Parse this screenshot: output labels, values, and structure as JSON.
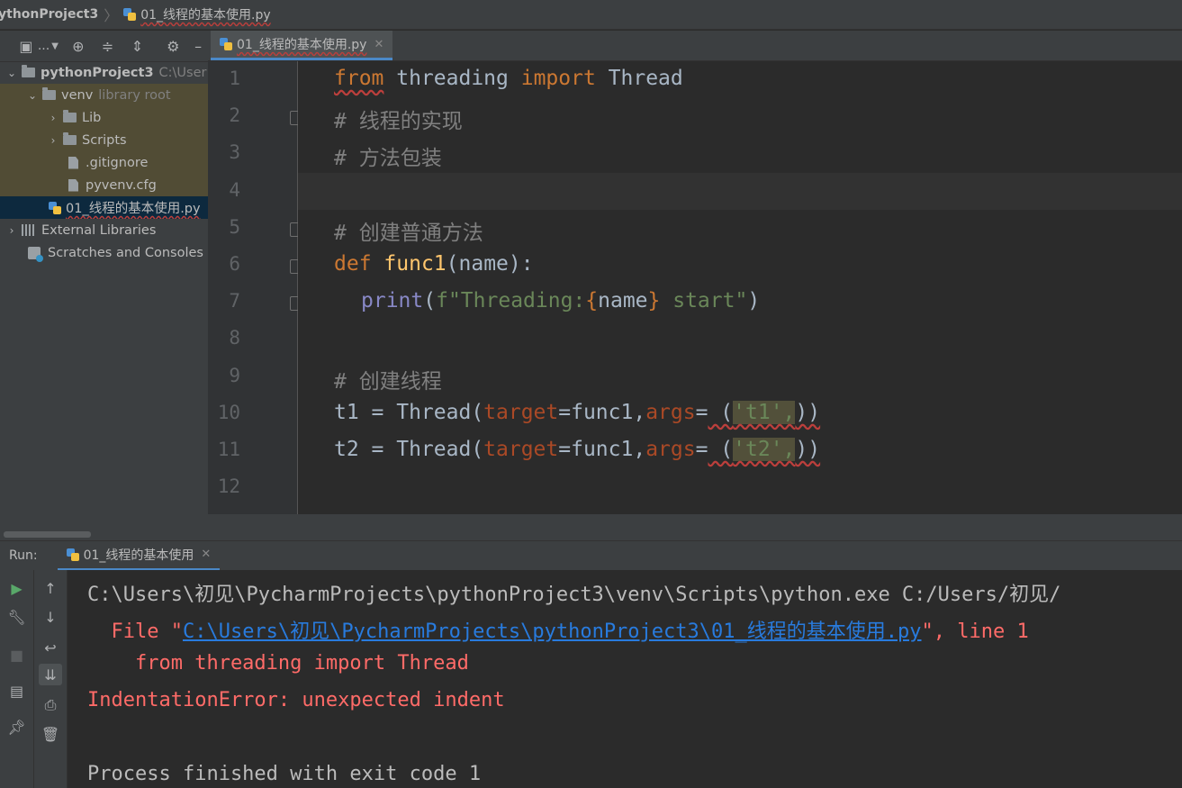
{
  "breadcrumb": {
    "project": "ythonProject3",
    "file": "01_线程的基本使用.py"
  },
  "sidebar": {
    "toolbar_label": "...",
    "tree": {
      "project_name": "pythonProject3",
      "project_path": "C:\\User",
      "venv": "venv",
      "venv_hint": "library root",
      "lib": "Lib",
      "scripts": "Scripts",
      "gitignore": ".gitignore",
      "pyvenv": "pyvenv.cfg",
      "file": "01_线程的基本使用.py",
      "external": "External Libraries",
      "scratches": "Scratches and Consoles"
    }
  },
  "editor": {
    "tab_label": "01_线程的基本使用.py",
    "line_numbers": [
      "1",
      "2",
      "3",
      "4",
      "5",
      "6",
      "7",
      "8",
      "9",
      "10",
      "11",
      "12"
    ],
    "code": {
      "l1": [
        "from",
        " threading ",
        "import",
        " Thread"
      ],
      "l2": "# 线程的实现",
      "l3": "# 方法包装",
      "l5": "# 创建普通方法",
      "l6": [
        "def",
        " ",
        "func1",
        "(name):"
      ],
      "l7": [
        "print",
        "(",
        "f\"Threading:",
        "{",
        "name",
        "}",
        " start\"",
        ")"
      ],
      "l9": "# 创建线程",
      "l10": [
        "t1 = Thread(",
        "target",
        "=func1,",
        "args",
        "=",
        " (",
        "'t1',",
        "))"
      ],
      "l11": [
        "t2 = Thread(",
        "target",
        "=func1,",
        "args",
        "=",
        " (",
        "'t2',",
        "))"
      ]
    }
  },
  "run": {
    "label": "Run:",
    "tab_label": "01_线程的基本使用",
    "console": {
      "line1": "C:\\Users\\初见\\PycharmProjects\\pythonProject3\\venv\\Scripts\\python.exe C:/Users/初见/",
      "line2_prefix": "  File \"",
      "line2_link": "C:\\Users\\初见\\PycharmProjects\\pythonProject3\\01_线程的基本使用.py",
      "line2_suffix": "\", line 1",
      "line3": "    from threading import Thread",
      "line4": "IndentationError: unexpected indent",
      "line6": "Process finished with exit code 1"
    }
  }
}
